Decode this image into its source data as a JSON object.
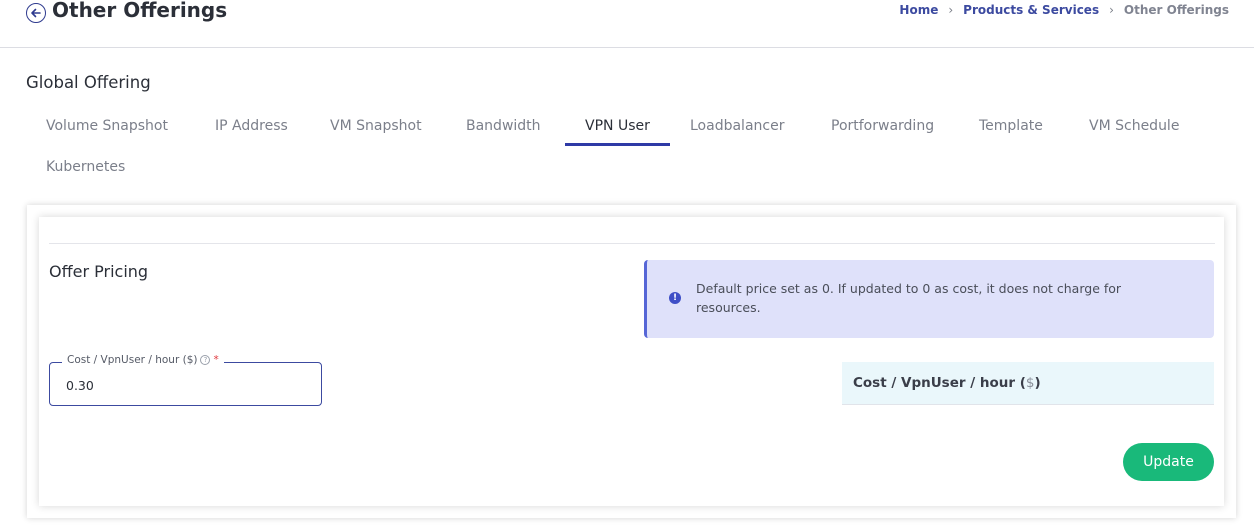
{
  "header": {
    "title": "Other Offerings",
    "breadcrumb": [
      {
        "label": "Home"
      },
      {
        "label": "Products & Services"
      },
      {
        "label": "Other Offerings"
      }
    ]
  },
  "section": {
    "title": "Global Offering"
  },
  "tabs": [
    {
      "label": "Volume Snapshot"
    },
    {
      "label": "IP Address"
    },
    {
      "label": "VM Snapshot"
    },
    {
      "label": "Bandwidth"
    },
    {
      "label": "VPN User",
      "active": true
    },
    {
      "label": "Loadbalancer"
    },
    {
      "label": "Portforwarding"
    },
    {
      "label": "Template"
    },
    {
      "label": "VM Schedule"
    },
    {
      "label": "Kubernetes"
    }
  ],
  "card": {
    "title": "Offer Pricing",
    "info_text": "Default price set as 0. If updated to 0 as cost, it does not charge for resources.",
    "field_label": "Cost / VpnUser / hour ($)",
    "field_required_mark": "*",
    "field_value": "0.30",
    "cost_header_label": "Cost / VpnUser / hour (",
    "cost_header_unit": "$",
    "cost_header_close": ")",
    "update_label": "Update"
  },
  "colors": {
    "accent": "#2e3aa6",
    "update_button": "#19b97a",
    "info_background": "#dfe1fa"
  }
}
